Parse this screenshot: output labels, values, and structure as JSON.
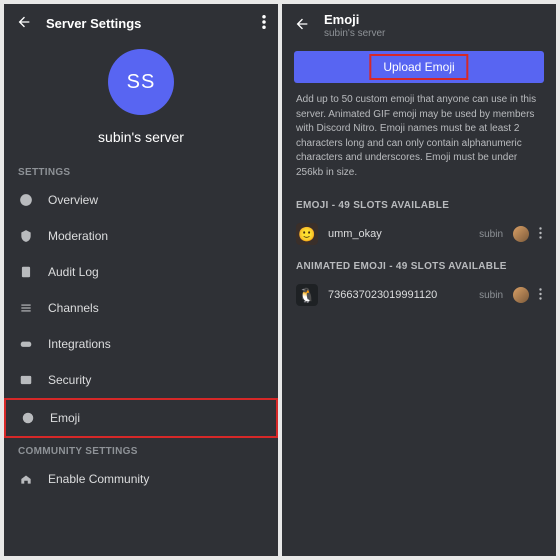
{
  "left": {
    "header_title": "Server Settings",
    "avatar_initials": "SS",
    "server_name": "subin's server",
    "section_settings": "SETTINGS",
    "items": {
      "overview": "Overview",
      "moderation": "Moderation",
      "audit": "Audit Log",
      "channels": "Channels",
      "integrations": "Integrations",
      "security": "Security",
      "emoji": "Emoji"
    },
    "section_community": "COMMUNITY SETTINGS",
    "community_item": "Enable Community"
  },
  "right": {
    "header_title": "Emoji",
    "header_sub": "subin's server",
    "upload_label": "Upload Emoji",
    "description": "Add up to 50 custom emoji that anyone can use in this server. Animated GIF emoji may be used by members with Discord Nitro. Emoji names must be at least 2 characters long and can only contain alphanumeric characters and underscores. Emoji must be under 256kb in size.",
    "emoji_slots_label": "EMOJI - 49 SLOTS AVAILABLE",
    "emoji1_name": "umm_okay",
    "emoji1_owner": "subin",
    "anim_slots_label": "ANIMATED EMOJI - 49 SLOTS AVAILABLE",
    "emoji2_name": "736637023019991120",
    "emoji2_owner": "subin"
  }
}
